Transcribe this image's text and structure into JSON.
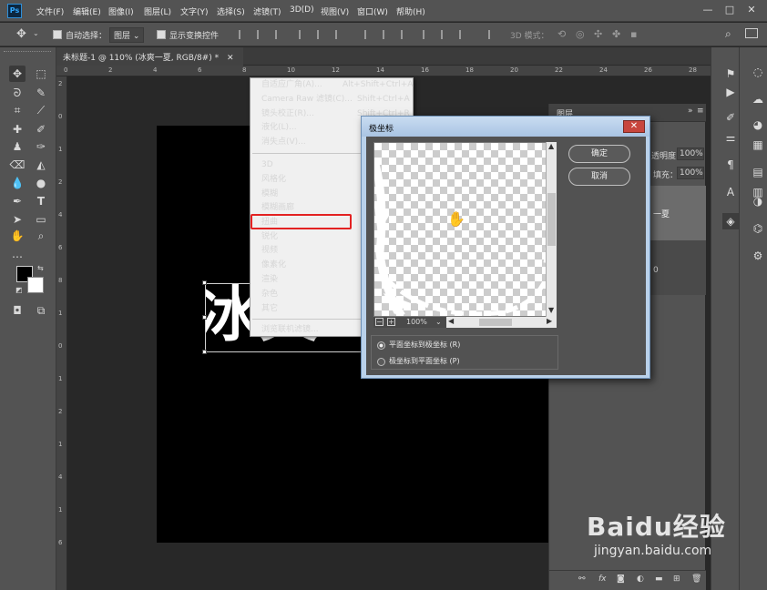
{
  "app": {
    "logo": "Ps"
  },
  "menubar": {
    "items": [
      "文件(F)",
      "编辑(E)",
      "图像(I)",
      "图层(L)",
      "文字(Y)",
      "选择(S)",
      "滤镜(T)",
      "3D(D)",
      "视图(V)",
      "窗口(W)",
      "帮助(H)"
    ],
    "window_controls": [
      "—",
      "□",
      "✕"
    ]
  },
  "options": {
    "auto_select_label": "自动选择：",
    "auto_select_value": "图层",
    "show_transform_label": "显示变换控件",
    "mode3d_label": "3D 模式："
  },
  "document": {
    "tab_title": "未标题-1 @ 110% (冰爽一夏, RGB/8#) *",
    "tab_close": "✕",
    "layer_text_visible": "冰爽"
  },
  "ruler": {
    "top_marks": [
      "0",
      "2",
      "4",
      "6",
      "8",
      "10",
      "12",
      "14",
      "16",
      "18",
      "20",
      "22",
      "24",
      "26",
      "28"
    ],
    "left_marks": [
      "2",
      "0",
      "1",
      "2",
      "4",
      "6",
      "8",
      "1",
      "0",
      "1",
      "2",
      "1",
      "4",
      "1",
      "6"
    ]
  },
  "filter_menu": {
    "top_items": [
      {
        "label": "自适应广角(A)...",
        "shortcut": "Alt+Shift+Ctrl+A"
      },
      {
        "label": "Camera Raw 滤镜(C)...",
        "shortcut": "Shift+Ctrl+A"
      },
      {
        "label": "镜头校正(R)...",
        "shortcut": "Shift+Ctrl+R"
      },
      {
        "label": "液化(L)...",
        "shortcut": "Shift+Ctrl+X"
      },
      {
        "label": "消失点(V)...",
        "shortcut": "Alt+Ctrl+V"
      }
    ],
    "groups": [
      "3D",
      "风格化",
      "模糊",
      "模糊画廊",
      "扭曲",
      "锐化",
      "视频",
      "像素化",
      "渲染",
      "杂色",
      "其它"
    ],
    "highlighted": "扭曲",
    "bottom_item": "浏览联机滤镜..."
  },
  "polar_dialog": {
    "title": "极坐标",
    "close": "✕",
    "ok": "确定",
    "cancel": "取消",
    "zoom": "100%",
    "zoom_minus": "−",
    "zoom_plus": "+",
    "option_rect_to_polar": "平面坐标到极坐标 (R)",
    "option_polar_to_rect": "极坐标到平面坐标 (P)",
    "selected_option": "rect_to_polar"
  },
  "layers_panel": {
    "tab": "图层",
    "opacity_label": "透明度：",
    "opacity_value": "100%",
    "fill_label": "填充：",
    "fill_value": "100%",
    "layer_name_partial": "一夏",
    "layer_index": "0",
    "footer_icons": [
      "link-icon",
      "fx-icon",
      "mask-icon",
      "adjustment-icon",
      "folder-icon",
      "new-layer-icon",
      "trash-icon"
    ]
  },
  "watermark": {
    "brand": "Baidu经验",
    "url": "jingyan.baidu.com"
  },
  "colors": {
    "foreground": "#000000",
    "background": "#ffffff",
    "highlight_border": "#e32222"
  }
}
